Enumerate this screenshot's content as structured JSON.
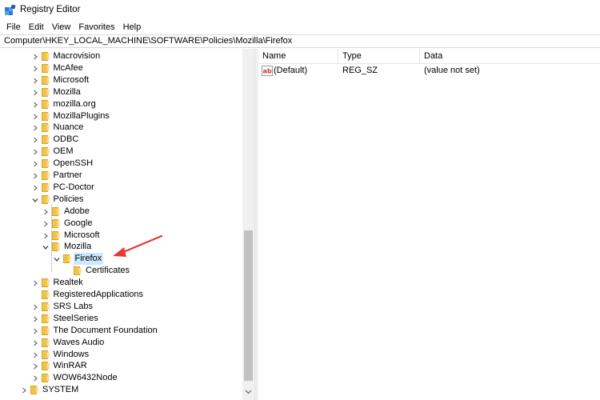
{
  "window": {
    "title": "Registry Editor"
  },
  "menu": [
    "File",
    "Edit",
    "View",
    "Favorites",
    "Help"
  ],
  "address": "Computer\\HKEY_LOCAL_MACHINE\\SOFTWARE\\Policies\\Mozilla\\Firefox",
  "tree": [
    {
      "label": "Macrovision",
      "depth": 3,
      "expander": "collapsed"
    },
    {
      "label": "McAfee",
      "depth": 3,
      "expander": "collapsed"
    },
    {
      "label": "Microsoft",
      "depth": 3,
      "expander": "collapsed"
    },
    {
      "label": "Mozilla",
      "depth": 3,
      "expander": "collapsed"
    },
    {
      "label": "mozilla.org",
      "depth": 3,
      "expander": "collapsed"
    },
    {
      "label": "MozillaPlugins",
      "depth": 3,
      "expander": "collapsed"
    },
    {
      "label": "Nuance",
      "depth": 3,
      "expander": "collapsed"
    },
    {
      "label": "ODBC",
      "depth": 3,
      "expander": "collapsed"
    },
    {
      "label": "OEM",
      "depth": 3,
      "expander": "collapsed"
    },
    {
      "label": "OpenSSH",
      "depth": 3,
      "expander": "collapsed"
    },
    {
      "label": "Partner",
      "depth": 3,
      "expander": "collapsed"
    },
    {
      "label": "PC-Doctor",
      "depth": 3,
      "expander": "collapsed"
    },
    {
      "label": "Policies",
      "depth": 3,
      "expander": "expanded"
    },
    {
      "label": "Adobe",
      "depth": 4,
      "expander": "collapsed"
    },
    {
      "label": "Google",
      "depth": 4,
      "expander": "collapsed"
    },
    {
      "label": "Microsoft",
      "depth": 4,
      "expander": "collapsed"
    },
    {
      "label": "Mozilla",
      "depth": 4,
      "expander": "expanded"
    },
    {
      "label": "Firefox",
      "depth": 5,
      "expander": "expanded",
      "selected": true
    },
    {
      "label": "Certificates",
      "depth": 6,
      "expander": "none"
    },
    {
      "label": "Realtek",
      "depth": 3,
      "expander": "collapsed"
    },
    {
      "label": "RegisteredApplications",
      "depth": 3,
      "expander": "none"
    },
    {
      "label": "SRS Labs",
      "depth": 3,
      "expander": "collapsed"
    },
    {
      "label": "SteelSeries",
      "depth": 3,
      "expander": "collapsed"
    },
    {
      "label": "The Document Foundation",
      "depth": 3,
      "expander": "collapsed"
    },
    {
      "label": "Waves Audio",
      "depth": 3,
      "expander": "collapsed"
    },
    {
      "label": "Windows",
      "depth": 3,
      "expander": "collapsed"
    },
    {
      "label": "WinRAR",
      "depth": 3,
      "expander": "collapsed"
    },
    {
      "label": "WOW6432Node",
      "depth": 3,
      "expander": "collapsed"
    },
    {
      "label": "SYSTEM",
      "depth": 2,
      "expander": "collapsed"
    }
  ],
  "list": {
    "columns": [
      "Name",
      "Type",
      "Data"
    ],
    "rows": [
      {
        "name": "(Default)",
        "type": "REG_SZ",
        "data": "(value not set)",
        "icon": "string-value-icon"
      }
    ]
  },
  "colors": {
    "selection": "#cce8ff",
    "folder": "#f0c34a",
    "annotation_arrow": "#e53935"
  }
}
